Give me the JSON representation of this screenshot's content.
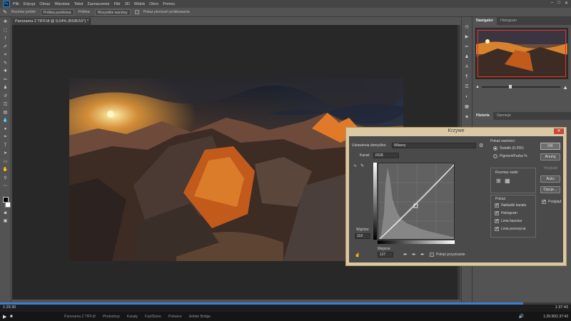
{
  "menubar": {
    "logo": "Ps",
    "items": [
      "Plik",
      "Edycja",
      "Obraz",
      "Warstwa",
      "Tekst",
      "Zaznaczenie",
      "Filtr",
      "3D",
      "Widok",
      "Okno",
      "Pomoc"
    ]
  },
  "options_bar": {
    "sample_label": "Rozmiar próbki:",
    "sample_value": "Próbka punktowa",
    "sample_all": "Próbka:",
    "sample_all_value": "Wszystkie warstwy",
    "ring_label": "Pokaż pierścień próbkowania"
  },
  "document_tab": "Panorama 2 TIFF.tif @ 9,04% (RGB/16*) *",
  "panels": {
    "top_tabs": [
      "Nawigator",
      "Histogram"
    ],
    "bottom_tabs": [
      "Historia",
      "Operacje"
    ],
    "zoom_fraction": 0.35
  },
  "curves_dialog": {
    "title": "Krzywe",
    "preset_label": "Ustawienia domyślne:",
    "preset_value": "Własny",
    "channel_label": "Kanał:",
    "channel_value": "RGB",
    "output_label": "Wyjście:",
    "output_value": "118",
    "input_label": "Wejście:",
    "input_value": "127",
    "show_clipping": "Pokaż przycinanie",
    "show_values_label": "Pokaż wartości:",
    "light_option": "Światło (0-255)",
    "pigment_option": "Pigment/Farba %",
    "grid_size_label": "Rozmiar siatki:",
    "show_label": "Pokaż:",
    "show_options": [
      "Nakładki kanału",
      "Histogram",
      "Linia bazowa",
      "Linia przecięcia"
    ],
    "buttons": {
      "ok": "OK",
      "cancel": "Anuluj",
      "smooth": "Wygładź",
      "auto": "Auto",
      "options": "Opcje...",
      "preview": "Podgląd"
    }
  },
  "player": {
    "elapsed": "1:29:30",
    "total": "1:37:43",
    "right_time": "1:29:30/1:37:43",
    "progress": 0.916
  },
  "taskbar": {
    "items": [
      "Panorama 2 TIFF.tif",
      "Photoshop",
      "Kanały",
      "FastStone",
      "Pobrane",
      "Adobe Bridge"
    ]
  },
  "colors": {
    "accent": "#3b7ed6",
    "dialog_border": "#dac9a4",
    "close_button": "#c7493a",
    "nav_frame": "#e0332a"
  }
}
